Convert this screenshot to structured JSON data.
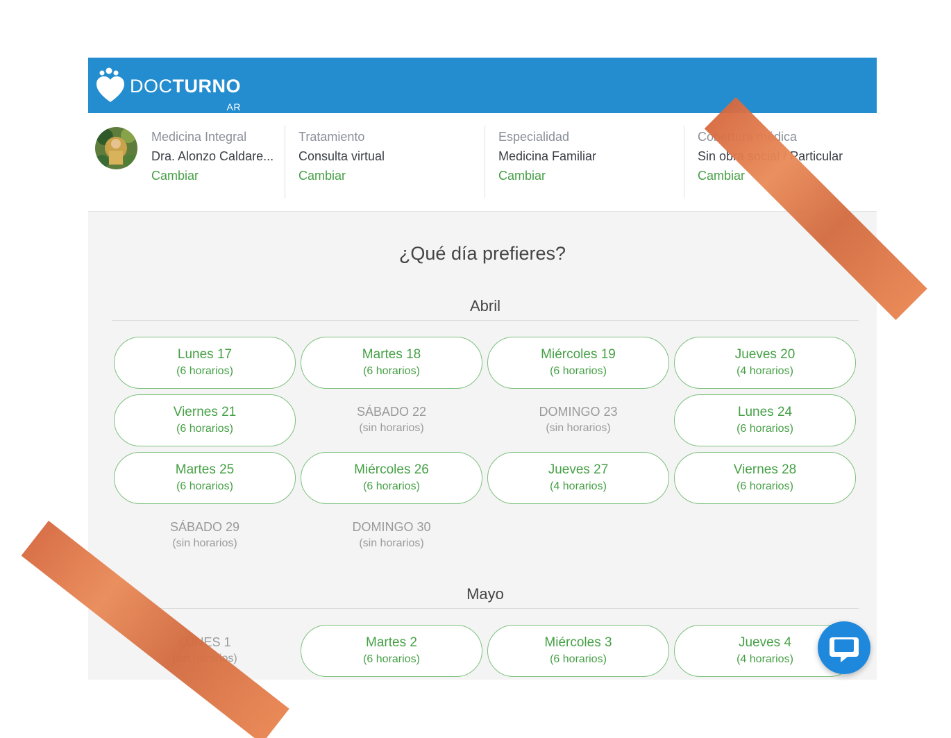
{
  "brand": {
    "name_light": "DOC",
    "name_bold": "TURNO",
    "country": "AR"
  },
  "info": [
    {
      "label": "Medicina Integral",
      "value": "Dra. Alonzo Caldare...",
      "action": "Cambiar"
    },
    {
      "label": "Tratamiento",
      "value": "Consulta virtual",
      "action": "Cambiar"
    },
    {
      "label": "Especialidad",
      "value": "Medicina Familiar",
      "action": "Cambiar"
    },
    {
      "label": "Cobertura médica",
      "value": "Sin obra social / Particular",
      "action": "Cambiar"
    }
  ],
  "question": "¿Qué día prefieres?",
  "months": [
    {
      "name": "Abril",
      "days": [
        {
          "day": "Lunes 17",
          "slots": "(6 horarios)",
          "available": true
        },
        {
          "day": "Martes 18",
          "slots": "(6 horarios)",
          "available": true
        },
        {
          "day": "Miércoles 19",
          "slots": "(6 horarios)",
          "available": true
        },
        {
          "day": "Jueves 20",
          "slots": "(4 horarios)",
          "available": true
        },
        {
          "day": "Viernes 21",
          "slots": "(6 horarios)",
          "available": true
        },
        {
          "day": "SÁBADO 22",
          "slots": "(sin horarios)",
          "available": false
        },
        {
          "day": "DOMINGO 23",
          "slots": "(sin horarios)",
          "available": false
        },
        {
          "day": "Lunes 24",
          "slots": "(6 horarios)",
          "available": true
        },
        {
          "day": "Martes 25",
          "slots": "(6 horarios)",
          "available": true
        },
        {
          "day": "Miércoles 26",
          "slots": "(6 horarios)",
          "available": true
        },
        {
          "day": "Jueves 27",
          "slots": "(4 horarios)",
          "available": true
        },
        {
          "day": "Viernes 28",
          "slots": "(6 horarios)",
          "available": true
        },
        {
          "day": "SÁBADO 29",
          "slots": "(sin horarios)",
          "available": false
        },
        {
          "day": "DOMINGO 30",
          "slots": "(sin horarios)",
          "available": false
        }
      ]
    },
    {
      "name": "Mayo",
      "days": [
        {
          "day": "LUNES 1",
          "slots": "(sin horarios)",
          "available": false
        },
        {
          "day": "Martes 2",
          "slots": "(6 horarios)",
          "available": true
        },
        {
          "day": "Miércoles 3",
          "slots": "(6 horarios)",
          "available": true
        },
        {
          "day": "Jueves 4",
          "slots": "(4 horarios)",
          "available": true
        }
      ]
    }
  ],
  "colors": {
    "header": "#238dcf",
    "accent": "#46a046",
    "chat": "#1e88dd",
    "tape": "#e07a4a"
  },
  "icons": {
    "logo": "heart-logo-icon",
    "chat": "chat-bubble-icon",
    "avatar": "doctor-avatar"
  }
}
